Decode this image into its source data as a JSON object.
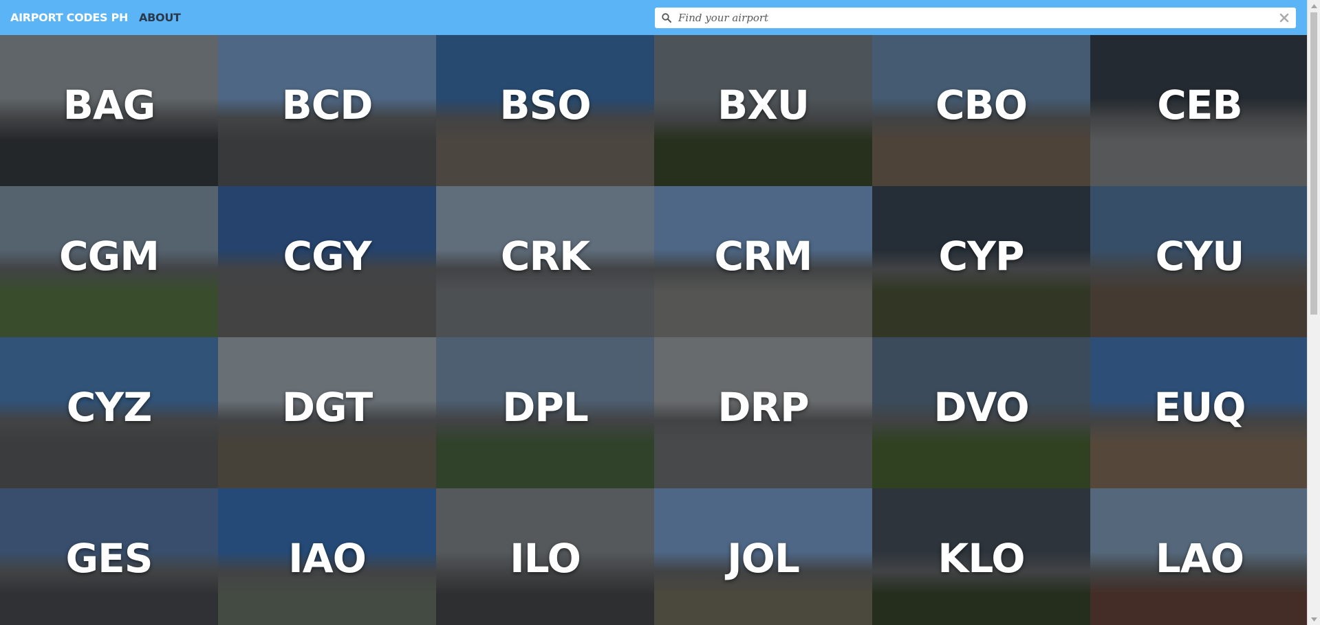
{
  "header": {
    "brand": "AIRPORT CODES PH",
    "nav_about": "ABOUT",
    "search_placeholder": "Find your airport"
  },
  "colors": {
    "header_bg": "#5ab4f5",
    "brand_text": "#ffffff",
    "about_text": "#2b3a4a",
    "tile_text": "#ffffff"
  },
  "airports": [
    {
      "code": "BAG",
      "sky": "#9aa3a8",
      "ground": "#3b3f44"
    },
    {
      "code": "BCD",
      "sky": "#7ea6d6",
      "ground": "#5a5d60"
    },
    {
      "code": "BSO",
      "sky": "#3f78b6",
      "ground": "#7a7166"
    },
    {
      "code": "BXU",
      "sky": "#7d8890",
      "ground": "#3f4e2e"
    },
    {
      "code": "CBO",
      "sky": "#6e93b8",
      "ground": "#7d6c5c"
    },
    {
      "code": "CEB",
      "sky": "#3b4550",
      "ground": "#8b8d8f"
    },
    {
      "code": "CGM",
      "sky": "#8aa0b4",
      "ground": "#5c7c48"
    },
    {
      "code": "CGY",
      "sky": "#3c6cae",
      "ground": "#6c6c6c"
    },
    {
      "code": "CRK",
      "sky": "#9bb1c7",
      "ground": "#7d8287"
    },
    {
      "code": "CRM",
      "sky": "#7ea7d8",
      "ground": "#8a8b87"
    },
    {
      "code": "CYP",
      "sky": "#3d4a57",
      "ground": "#4f5a3a"
    },
    {
      "code": "CYU",
      "sky": "#5a7fa8",
      "ground": "#6e5e50"
    },
    {
      "code": "CYZ",
      "sky": "#4f86c2",
      "ground": "#5f6264"
    },
    {
      "code": "DGT",
      "sky": "#a8b4bd",
      "ground": "#72695d"
    },
    {
      "code": "DPL",
      "sky": "#7d99b5",
      "ground": "#4e6b45"
    },
    {
      "code": "DRP",
      "sky": "#a9adb0",
      "ground": "#74777a"
    },
    {
      "code": "DVO",
      "sky": "#5f7a94",
      "ground": "#4c6a35"
    },
    {
      "code": "EUQ",
      "sky": "#4a7fbf",
      "ground": "#8a7560"
    },
    {
      "code": "GES",
      "sky": "#5b7fae",
      "ground": "#4d5054"
    },
    {
      "code": "IAO",
      "sky": "#3d78c0",
      "ground": "#6f7a6c"
    },
    {
      "code": "ILO",
      "sky": "#8a9095",
      "ground": "#4a4d50"
    },
    {
      "code": "JOL",
      "sky": "#7ea6d8",
      "ground": "#7a7464"
    },
    {
      "code": "KLO",
      "sky": "#4a5560",
      "ground": "#3c4a30"
    },
    {
      "code": "LAO",
      "sky": "#8aa9c7",
      "ground": "#6c4a3e"
    }
  ]
}
